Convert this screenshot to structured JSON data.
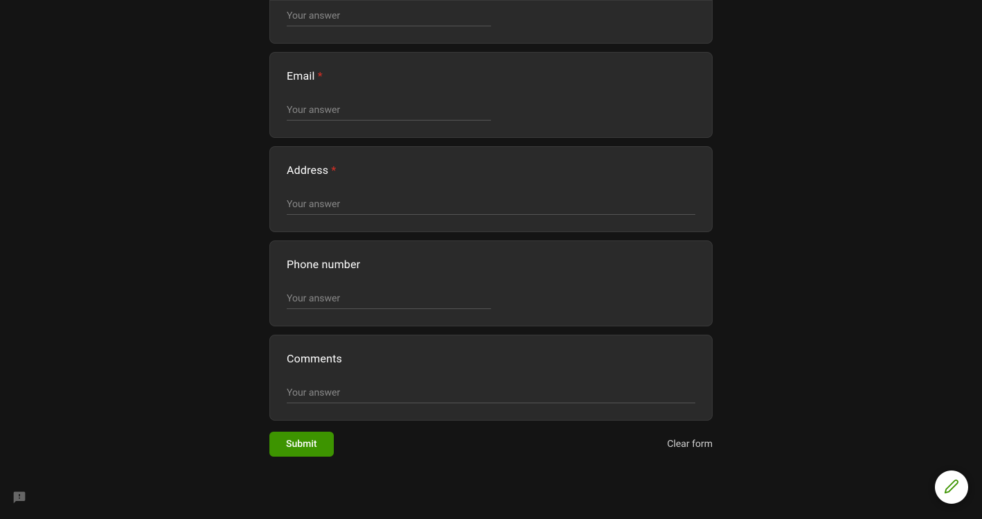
{
  "placeholder": "Your answer",
  "fields": {
    "name": {
      "label": "",
      "required": false
    },
    "email": {
      "label": "Email",
      "required": true
    },
    "address": {
      "label": "Address",
      "required": true
    },
    "phone": {
      "label": "Phone number",
      "required": false
    },
    "comments": {
      "label": "Comments",
      "required": false
    }
  },
  "required_marker": "*",
  "actions": {
    "submit": "Submit",
    "clear": "Clear form"
  },
  "colors": {
    "accent": "#3d9400",
    "required": "#d93025",
    "card_bg": "#2a2a2a",
    "page_bg": "#141414"
  }
}
